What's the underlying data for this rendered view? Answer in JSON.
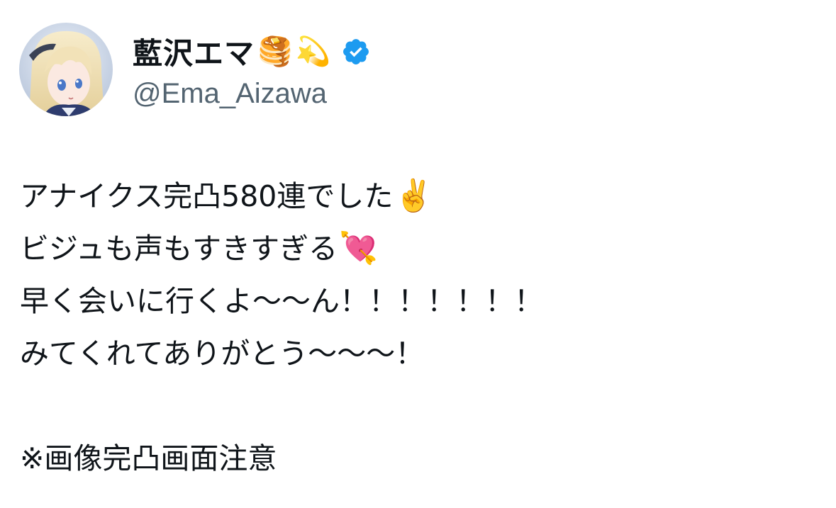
{
  "author": {
    "display_name": "藍沢エマ",
    "name_emojis": [
      "🥞",
      "💫"
    ],
    "handle": "@Ema_Aizawa",
    "verified_icon": "verified-badge-icon",
    "verified_color": "#1d9bf0"
  },
  "tweet": {
    "lines": [
      {
        "text": "アナイクス完凸580連でした",
        "emoji": "✌️"
      },
      {
        "text": "ビジュも声もすきすぎる",
        "emoji": "💘"
      },
      {
        "text": "早く会いに行くよ〜〜ん！！！！！！！",
        "emoji": ""
      },
      {
        "text": "みてくれてありがとう〜〜〜！",
        "emoji": ""
      },
      {
        "text": "",
        "emoji": ""
      },
      {
        "text": "※画像完凸画面注意",
        "emoji": ""
      }
    ]
  },
  "colors": {
    "text": "#0f1419",
    "secondary_text": "#536471",
    "background": "#ffffff"
  }
}
